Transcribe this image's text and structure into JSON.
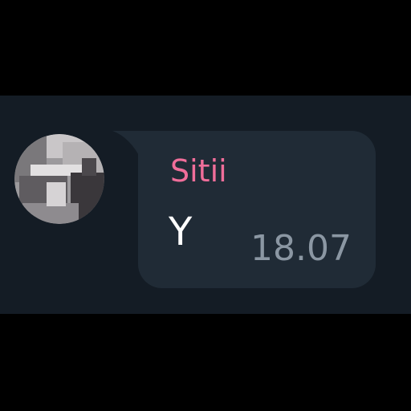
{
  "message": {
    "sender_name": "Sitii",
    "text": "Y",
    "timestamp": "18.07"
  },
  "colors": {
    "background": "#000000",
    "chat_background": "#141c25",
    "bubble": "#202b36",
    "sender_name": "#f06e9a",
    "text": "#ffffff",
    "timestamp": "#8b97a3"
  },
  "icons": {
    "avatar": "user-avatar-photo"
  }
}
